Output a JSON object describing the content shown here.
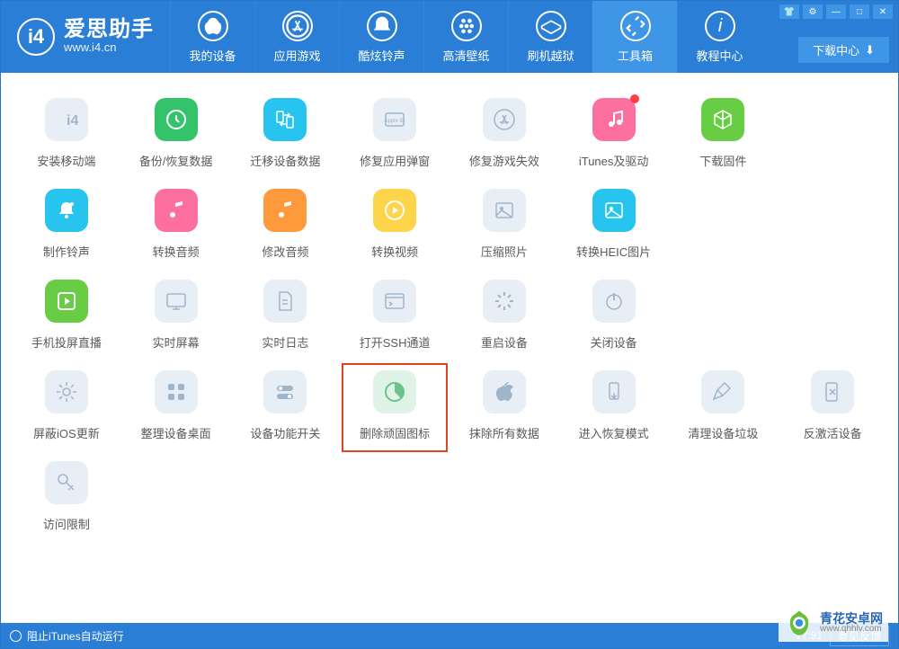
{
  "app": {
    "title": "爱思助手",
    "site": "www.i4.cn"
  },
  "nav": [
    {
      "label": "我的设备"
    },
    {
      "label": "应用游戏"
    },
    {
      "label": "酷炫铃声"
    },
    {
      "label": "高清壁纸"
    },
    {
      "label": "刷机越狱"
    },
    {
      "label": "工具箱",
      "active": true
    },
    {
      "label": "教程中心"
    }
  ],
  "download_button": "下载中心",
  "tools": {
    "r1": [
      {
        "id": "install-mobile",
        "label": "安装移动端",
        "bg": "c-bl",
        "ic": "i4",
        "lt": true
      },
      {
        "id": "backup-restore",
        "label": "备份/恢复数据",
        "bg": "c-gr",
        "ic": "clock-back"
      },
      {
        "id": "migrate-data",
        "label": "迁移设备数据",
        "bg": "c-cy",
        "ic": "transfer"
      },
      {
        "id": "fix-popup",
        "label": "修复应用弹窗",
        "bg": "c-bl",
        "ic": "appleid",
        "lt": true
      },
      {
        "id": "fix-game",
        "label": "修复游戏失效",
        "bg": "c-bl",
        "ic": "appstore",
        "lt": true
      },
      {
        "id": "itunes-driver",
        "label": "iTunes及驱动",
        "bg": "c-rd",
        "ic": "music",
        "dot": true
      },
      {
        "id": "download-fw",
        "label": "下载固件",
        "bg": "c-gn2",
        "ic": "cube"
      }
    ],
    "r2": [
      {
        "id": "make-ringtone",
        "label": "制作铃声",
        "bg": "c-cy",
        "ic": "bell"
      },
      {
        "id": "convert-audio",
        "label": "转换音频",
        "bg": "c-rd",
        "ic": "music2"
      },
      {
        "id": "edit-audio",
        "label": "修改音频",
        "bg": "c-or",
        "ic": "music2"
      },
      {
        "id": "convert-video",
        "label": "转换视频",
        "bg": "c-ye",
        "ic": "play"
      },
      {
        "id": "compress-photo",
        "label": "压缩照片",
        "bg": "c-bl",
        "ic": "image",
        "lt": true
      },
      {
        "id": "convert-heic",
        "label": "转换HEIC图片",
        "bg": "c-cy",
        "ic": "image"
      }
    ],
    "r3": [
      {
        "id": "screen-cast",
        "label": "手机投屏直播",
        "bg": "c-gn2",
        "ic": "play2"
      },
      {
        "id": "realtime-screen",
        "label": "实时屏幕",
        "bg": "c-bl",
        "ic": "monitor",
        "lt": true
      },
      {
        "id": "realtime-log",
        "label": "实时日志",
        "bg": "c-bl",
        "ic": "doc",
        "lt": true
      },
      {
        "id": "open-ssh",
        "label": "打开SSH通道",
        "bg": "c-bl",
        "ic": "terminal",
        "lt": true
      },
      {
        "id": "reboot",
        "label": "重启设备",
        "bg": "c-bl",
        "ic": "loading",
        "lt": true
      },
      {
        "id": "shutdown",
        "label": "关闭设备",
        "bg": "c-bl",
        "ic": "power",
        "lt": true
      }
    ],
    "r4": [
      {
        "id": "block-ios-update",
        "label": "屏蔽iOS更新",
        "bg": "c-bl",
        "ic": "gear",
        "lt": true
      },
      {
        "id": "arrange-desktop",
        "label": "整理设备桌面",
        "bg": "c-bl",
        "ic": "grid",
        "lt": true
      },
      {
        "id": "feature-switch",
        "label": "设备功能开关",
        "bg": "c-bl",
        "ic": "toggles",
        "lt": true
      },
      {
        "id": "delete-icons",
        "label": "删除顽固图标",
        "bg": "c-lg",
        "ic": "pie",
        "hl": true
      },
      {
        "id": "erase-data",
        "label": "抹除所有数据",
        "bg": "c-bl",
        "ic": "apple-x",
        "lt": true
      },
      {
        "id": "recovery-mode",
        "label": "进入恢复模式",
        "bg": "c-bl",
        "ic": "phone-down",
        "lt": true
      },
      {
        "id": "clean-trash",
        "label": "清理设备垃圾",
        "bg": "c-bl",
        "ic": "broom",
        "lt": true
      },
      {
        "id": "deactivate",
        "label": "反激活设备",
        "bg": "c-bl",
        "ic": "phone-x",
        "lt": true
      }
    ],
    "r5": [
      {
        "id": "access-restrict",
        "label": "访问限制",
        "bg": "c-bl",
        "ic": "key",
        "lt": true
      }
    ]
  },
  "footer": {
    "block_itunes": "阻止iTunes自动运行",
    "version": "V7.91",
    "feedback": "意见反馈"
  },
  "watermark": {
    "title": "青花安卓网",
    "url": "www.qhhlv.com"
  }
}
